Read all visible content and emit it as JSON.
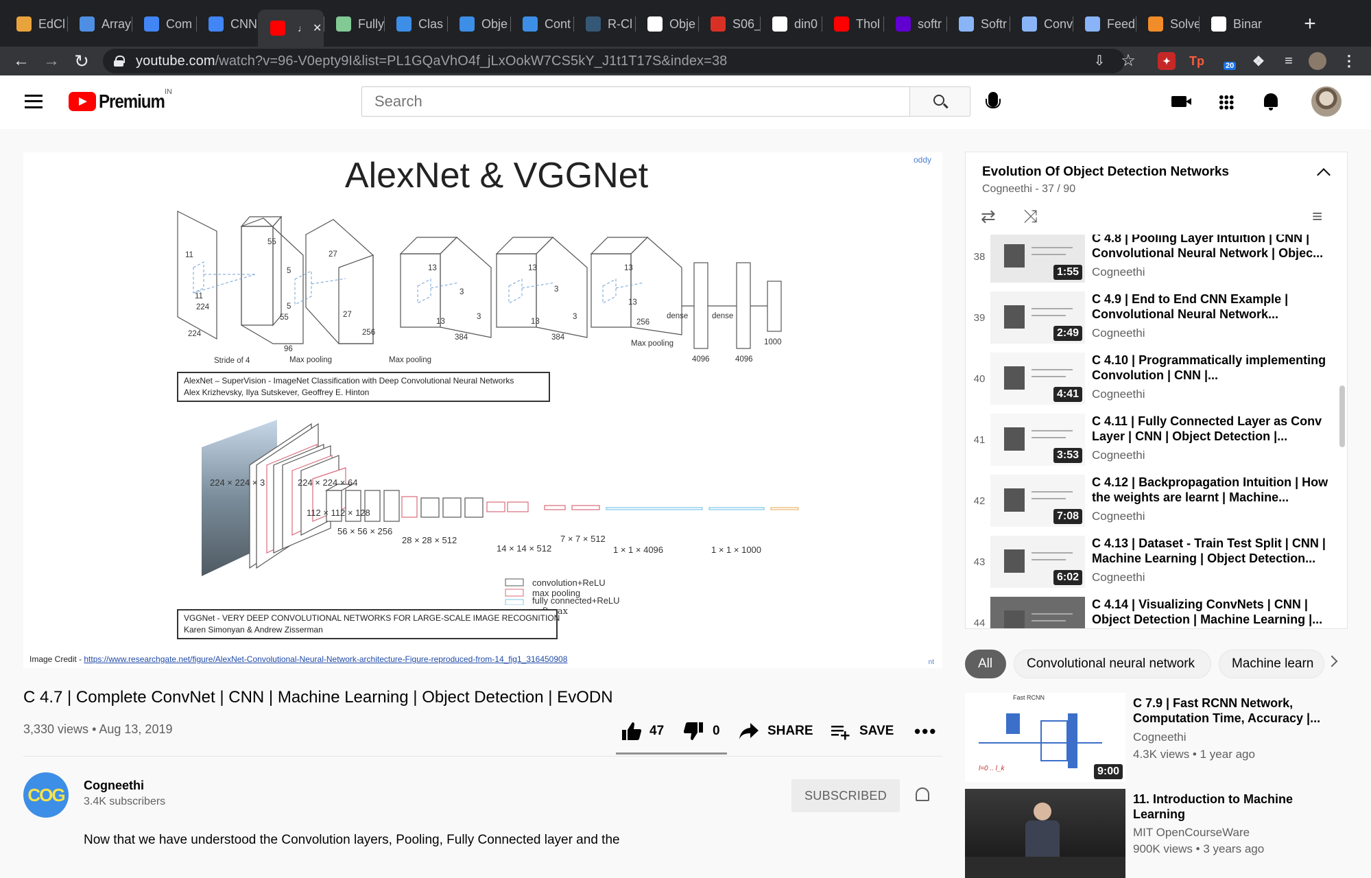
{
  "browser": {
    "tabs": [
      {
        "label": "EdCl",
        "icon": "edclub-icon",
        "color": "#e8a33d"
      },
      {
        "label": "Array",
        "icon": "interviewbit-icon",
        "color": "#4f8fe3"
      },
      {
        "label": "Com",
        "icon": "docs-icon",
        "color": "#4285f4"
      },
      {
        "label": "CNN",
        "icon": "docs-icon",
        "color": "#4285f4"
      },
      {
        "label": "",
        "icon": "youtube-icon",
        "color": "#ff0000",
        "active": true
      },
      {
        "label": "Fully",
        "icon": "link-icon",
        "color": "#81c995"
      },
      {
        "label": "Clas",
        "icon": "cog-icon",
        "color": "#3d8ee6"
      },
      {
        "label": "Obje",
        "icon": "cog-icon",
        "color": "#3d8ee6"
      },
      {
        "label": "Cont",
        "icon": "cog-icon",
        "color": "#3d8ee6"
      },
      {
        "label": "R-Cl",
        "icon": "tds-icon",
        "color": "#355876"
      },
      {
        "label": "Obje",
        "icon": "github-icon",
        "color": "#ffffff"
      },
      {
        "label": "S06_",
        "icon": "pdf-icon",
        "color": "#d93025"
      },
      {
        "label": "din0",
        "icon": "github-icon",
        "color": "#ffffff"
      },
      {
        "label": "Thol",
        "icon": "youtube-icon",
        "color": "#ff0000"
      },
      {
        "label": "softr",
        "icon": "yahoo-icon",
        "color": "#6001d2"
      },
      {
        "label": "Softr",
        "icon": "brackets-icon",
        "color": "#8ab4f8"
      },
      {
        "label": "Conv",
        "icon": "brackets-icon",
        "color": "#8ab4f8"
      },
      {
        "label": "Feed",
        "icon": "brackets-icon",
        "color": "#8ab4f8"
      },
      {
        "label": "Solve",
        "icon": "c-icon",
        "color": "#f28c28"
      },
      {
        "label": "Binar",
        "icon": "medium-icon",
        "color": "#ffffff"
      }
    ],
    "url_domain": "youtube.com",
    "url_path": "/watch?v=96-V0epty9I&list=PL1GQaVhO4f_jLxOokW7CS5kY_J1t1T17S&index=38",
    "ext_badge": "20"
  },
  "header": {
    "logo_text": "Premium",
    "logo_country": "IN",
    "search_placeholder": "Search"
  },
  "slide": {
    "title": "AlexNet & VGGNet",
    "corner_top": "oddy",
    "corner_bottom": "nt",
    "alexnet_caption": "AlexNet – SuperVision - ImageNet Classification with Deep Convolutional Neural Networks\nAlex Krizhevsky, Ilya Sutskever, Geoffrey E. Hinton",
    "vggnet_caption": "VGGNet - VERY DEEP CONVOLUTIONAL NETWORKS FOR LARGE-SCALE IMAGE RECOGNITION\nKaren Simonyan & Andrew Zisserman",
    "credit_label": "Image Credit - ",
    "credit_link": "https://www.researchgate.net/figure/AlexNet-Convolutional-Neural-Network-architecture-Figure-reproduced-from-14_fig1_316450908",
    "alex_labels": {
      "in_h": "11",
      "in_w": "11",
      "in_size": "224",
      "in_size2": "224",
      "stride": "Stride of 4",
      "c1_top": "55",
      "c1_k": "5",
      "c1_k2": "5",
      "c1_side": "55",
      "c1_depth": "96",
      "c1_pool": "Max pooling",
      "c2_top": "27",
      "c2_side": "27",
      "c2_depth": "256",
      "c2_pool": "Max pooling",
      "c3_top": "13",
      "c3_k": "3",
      "c3_k2": "3",
      "c3_side": "13",
      "c3_depth": "384",
      "c4_top": "13",
      "c4_k": "3",
      "c4_k2": "3",
      "c4_side": "13",
      "c4_depth": "384",
      "c5_top": "13",
      "c5_side": "13",
      "c5_depth": "256",
      "c5_pool": "Max pooling",
      "dense1": "dense",
      "dense2": "dense",
      "fc1": "4096",
      "fc2": "4096",
      "fc3": "1000"
    },
    "vgg_labels": {
      "l1": "224 × 224 × 3",
      "l2": "224 × 224 × 64",
      "l3": "112 × 112 × 128",
      "l4": "56 × 56 × 256",
      "l5": "28 × 28 × 512",
      "l6": "14 × 14 × 512",
      "l7": "7 × 7 × 512",
      "l8": "1 × 1 × 4096",
      "l9": "1 × 1 × 1000"
    },
    "legend": [
      {
        "label": "convolution+ReLU",
        "color": "#555555"
      },
      {
        "label": "max pooling",
        "color": "#d96a7a"
      },
      {
        "label": "fully connected+ReLU",
        "color": "#7cc6e8"
      },
      {
        "label": "softmax",
        "color": "#e8b36a"
      }
    ]
  },
  "video": {
    "title": "C 4.7 | Complete ConvNet | CNN | Machine Learning | Object Detection | EvODN",
    "views": "3,330 views",
    "date": "Aug 13, 2019",
    "likes": "47",
    "dislikes": "0",
    "share_label": "SHARE",
    "save_label": "SAVE"
  },
  "channel": {
    "avatar_text": "COG",
    "name": "Cogneethi",
    "subscribers": "3.4K subscribers",
    "subscribe_label": "SUBSCRIBED"
  },
  "description": "Now that we have understood the Convolution layers, Pooling, Fully Connected layer and the",
  "playlist": {
    "title": "Evolution Of Object Detection Networks",
    "channel": "Cogneethi",
    "position": "37 / 90",
    "items": [
      {
        "index": "38",
        "title": "C 4.8 | Pooling Layer Intuition | CNN | Convolutional Neural Network | Objec...",
        "channel": "Cogneethi",
        "duration": "1:55"
      },
      {
        "index": "39",
        "title": "C 4.9 | End to End CNN Example | Convolutional Neural Network...",
        "channel": "Cogneethi",
        "duration": "2:49"
      },
      {
        "index": "40",
        "title": "C 4.10 | Programmatically implementing Convolution | CNN |...",
        "channel": "Cogneethi",
        "duration": "4:41"
      },
      {
        "index": "41",
        "title": "C 4.11 | Fully Connected Layer as Conv Layer | CNN | Object Detection |...",
        "channel": "Cogneethi",
        "duration": "3:53"
      },
      {
        "index": "42",
        "title": "C 4.12 | Backpropagation Intuition | How the weights are learnt | Machine...",
        "channel": "Cogneethi",
        "duration": "7:08"
      },
      {
        "index": "43",
        "title": "C 4.13 | Dataset - Train Test Split | CNN | Machine Learning | Object Detection...",
        "channel": "Cogneethi",
        "duration": "6:02"
      },
      {
        "index": "44",
        "title": "C 4.14 | Visualizing ConvNets | CNN | Object Detection | Machine Learning |...",
        "channel": "Cogneethi",
        "duration": ""
      }
    ]
  },
  "chips": [
    "All",
    "Convolutional neural network",
    "Machine learn"
  ],
  "recommendations": [
    {
      "title": "C 7.9 | Fast RCNN Network, Computation Time, Accuracy |...",
      "channel": "Cogneethi",
      "views": "4.3K views",
      "age": "1 year ago",
      "duration": "9:00",
      "thumb_caption": "Fast RCNN"
    },
    {
      "title": "11. Introduction to Machine Learning",
      "channel": "MIT OpenCourseWare",
      "views": "900K views",
      "age": "3 years ago",
      "duration": ""
    }
  ]
}
